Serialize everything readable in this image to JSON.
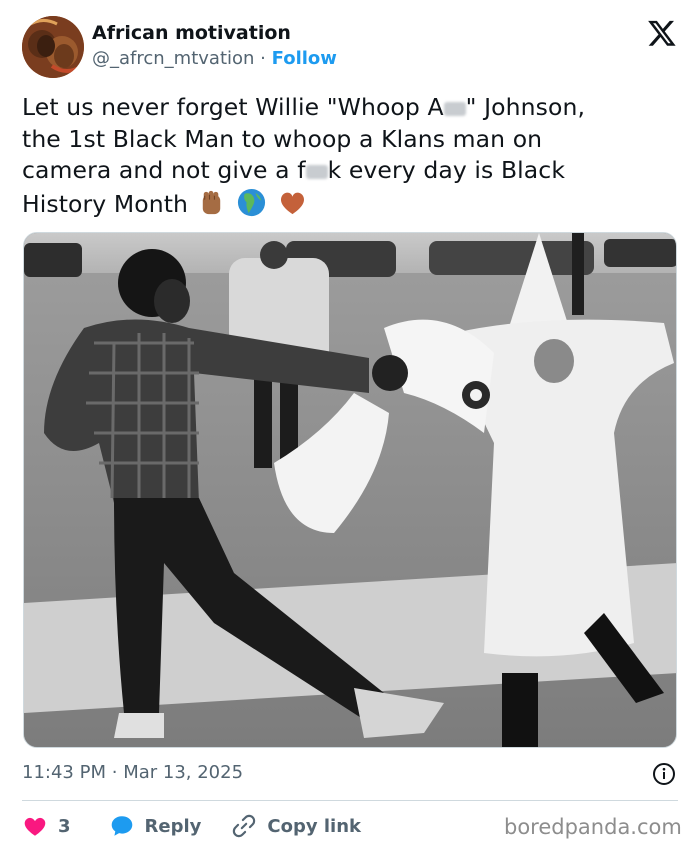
{
  "author": {
    "display_name": "African motivation",
    "handle": "@_afrcn_mtvation",
    "separator": "·",
    "follow_label": "Follow"
  },
  "tweet": {
    "line1": "Let us never forget Willie \"Whoop A",
    "line1_after": "\" Johnson,",
    "line2": "the 1st Black Man to whoop a Klans man on",
    "line3a": "camera and not give a f",
    "line3b": "k  every day is Black",
    "line4": "History Month",
    "emojis": [
      "raised-fist-medium-dark-skin",
      "globe-africa",
      "brown-heart"
    ]
  },
  "meta": {
    "time": "11:43 PM",
    "separator": "·",
    "date": "Mar 13, 2025"
  },
  "actions": {
    "likes": "3",
    "reply_label": "Reply",
    "copy_label": "Copy link"
  },
  "watermark": "boredpanda.com",
  "colors": {
    "link": "#1d9bf0",
    "like": "#f91880",
    "reply": "#1d9bf0",
    "muted": "#536471"
  }
}
